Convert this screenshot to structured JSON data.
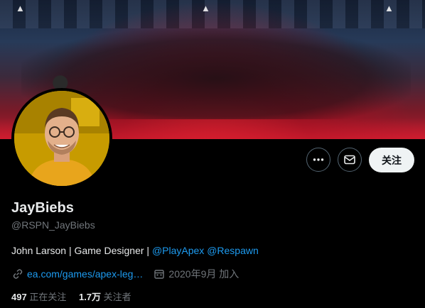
{
  "banner": {
    "logo": "▲"
  },
  "actions": {
    "more_icon": "more-icon",
    "message_icon": "envelope-icon",
    "follow_label": "关注"
  },
  "profile": {
    "display_name": "JayBiebs",
    "handle": "@RSPN_JayBiebs",
    "bio_text": "John Larson | Game Designer | ",
    "bio_mention_1": "@PlayApex",
    "bio_mention_2": "@Respawn",
    "website": "ea.com/games/apex-leg…",
    "joined": "2020年9月 加入",
    "following_count": "497",
    "following_label": "正在关注",
    "followers_count": "1.7万",
    "followers_label": "关注者"
  },
  "colors": {
    "background": "#000000",
    "link": "#1d9bf0",
    "muted": "#71767b",
    "follow_button": "#eff3f4"
  }
}
